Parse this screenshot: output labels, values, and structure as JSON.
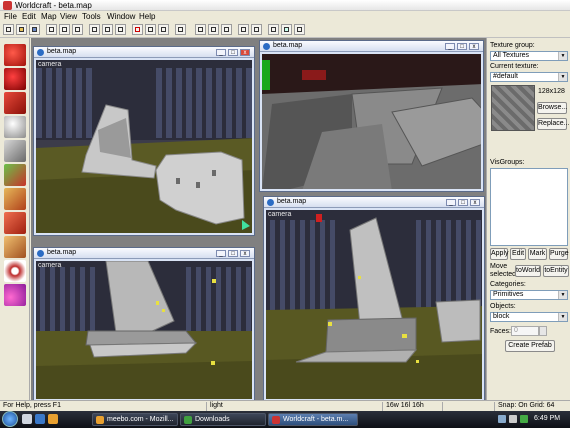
{
  "title": "Worldcraft - beta.map",
  "menu": [
    "File",
    "Edit",
    "Map",
    "View",
    "Tools",
    "Window",
    "Help"
  ],
  "windows": {
    "w1": {
      "title": "beta.map",
      "camera": "camera"
    },
    "w2": {
      "title": "beta.map"
    },
    "w3": {
      "title": "beta.map",
      "camera": "camera"
    },
    "w4": {
      "title": "beta.map",
      "camera": "camera"
    }
  },
  "caption_buttons": {
    "min": "_",
    "max": "□",
    "close": "x"
  },
  "right_panel": {
    "texture_group_label": "Texture group:",
    "texture_group_value": "All Textures",
    "current_texture_label": "Current texture:",
    "current_texture_value": "#default",
    "texture_size": "128x128",
    "browse": "Browse...",
    "replace": "Replace...",
    "visgroups_label": "VisGroups:",
    "apply": "Apply",
    "edit": "Edit",
    "mark": "Mark",
    "purge": "Purge",
    "move_selected_label": "Move selected:",
    "to_world": "toWorld",
    "to_entity": "toEntity",
    "categories_label": "Categories:",
    "categories_value": "Primitives",
    "objects_label": "Objects:",
    "objects_value": "block",
    "faces_label": "Faces:",
    "faces_value": "0",
    "create_prefab": "Create Prefab"
  },
  "status": {
    "help": "For Help, press F1",
    "light": "light",
    "dims": "16w 16l 16h",
    "snap": "Snap: On Grid: 64"
  },
  "taskbar": {
    "items": [
      "meebo.com - Mozill...",
      "Downloads",
      "Worldcraft - beta.m..."
    ],
    "time": "6:49 PM"
  },
  "colors": {
    "accent": "#2b6cc4",
    "taskbar": "#1a1e26",
    "active_tab": "#3d5f8f"
  }
}
